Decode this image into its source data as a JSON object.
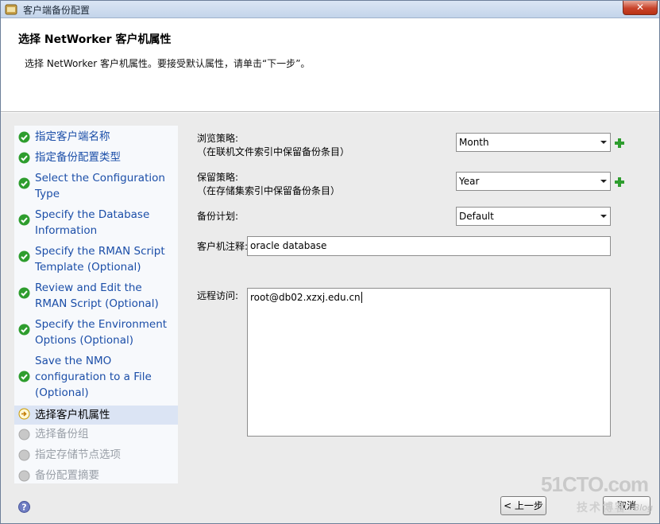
{
  "window": {
    "title": "客户端备份配置",
    "close_label": "✕"
  },
  "header": {
    "title": "选择 NetWorker 客户机属性",
    "description": "选择 NetWorker 客户机属性。要接受默认属性，请单击“下一步”。"
  },
  "steps": [
    {
      "label": "指定客户端名称",
      "status": "done"
    },
    {
      "label": "指定备份配置类型",
      "status": "done"
    },
    {
      "label": "Select the Configuration Type",
      "status": "done"
    },
    {
      "label": "Specify the Database Information",
      "status": "done"
    },
    {
      "label": "Specify the RMAN Script Template (Optional)",
      "status": "done"
    },
    {
      "label": "Review and Edit the RMAN Script (Optional)",
      "status": "done"
    },
    {
      "label": "Specify the Environment Options (Optional)",
      "status": "done"
    },
    {
      "label": "Save the NMO configuration to a File (Optional)",
      "status": "done"
    },
    {
      "label": "选择客户机属性",
      "status": "current"
    },
    {
      "label": "选择备份组",
      "status": "pending"
    },
    {
      "label": "指定存储节点选项",
      "status": "pending"
    },
    {
      "label": "备份配置摘要",
      "status": "pending"
    }
  ],
  "form": {
    "browse_policy": {
      "label": "浏览策略:",
      "sublabel": "（在联机文件索引中保留备份条目）",
      "value": "Month"
    },
    "retention_policy": {
      "label": "保留策略:",
      "sublabel": "（在存储集索引中保留备份条目）",
      "value": "Year"
    },
    "schedule": {
      "label": "备份计划:",
      "value": "Default"
    },
    "client_comment": {
      "label": "客户机注释:",
      "value": "oracle database"
    },
    "remote_access": {
      "label": "远程访问:",
      "value": "root@db02.xzxj.edu.cn"
    }
  },
  "buttons": {
    "back": "< 上一步",
    "cancel": "取消"
  },
  "watermark": {
    "site": "51CTO.com",
    "tagline": "技术博客",
    "blog": "Blog"
  },
  "colors": {
    "done_icon": "#2e9d2e",
    "link_text": "#1b4ea8",
    "current_icon": "#e8b400",
    "plus_icon": "#2e9d2e"
  }
}
